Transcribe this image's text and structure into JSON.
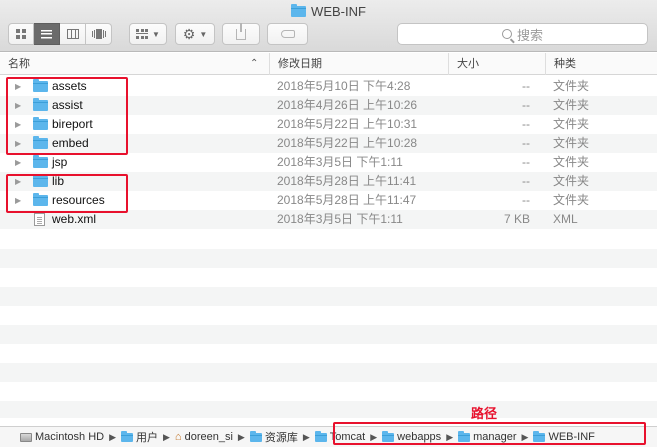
{
  "window": {
    "title": "WEB-INF"
  },
  "toolbar": {
    "view_modes": [
      "icon-view",
      "list-view",
      "column-view",
      "cover-flow-view"
    ],
    "active_view": "list-view",
    "arrange_icon": "arrange-icon",
    "action_icon": "gear-icon",
    "share_icon": "share-icon",
    "tag_icon": "tag-icon"
  },
  "search": {
    "placeholder": "搜索"
  },
  "columns": {
    "name": "名称",
    "date": "修改日期",
    "size": "大小",
    "kind": "种类"
  },
  "files": [
    {
      "name": "assets",
      "date": "2018年5月10日 下午4:28",
      "size": "--",
      "kind": "文件夹",
      "type": "folder"
    },
    {
      "name": "assist",
      "date": "2018年4月26日 上午10:26",
      "size": "--",
      "kind": "文件夹",
      "type": "folder"
    },
    {
      "name": "bireport",
      "date": "2018年5月22日 上午10:31",
      "size": "--",
      "kind": "文件夹",
      "type": "folder"
    },
    {
      "name": "embed",
      "date": "2018年5月22日 上午10:28",
      "size": "--",
      "kind": "文件夹",
      "type": "folder"
    },
    {
      "name": "jsp",
      "date": "2018年3月5日 下午1:11",
      "size": "--",
      "kind": "文件夹",
      "type": "folder"
    },
    {
      "name": "lib",
      "date": "2018年5月28日 上午11:41",
      "size": "--",
      "kind": "文件夹",
      "type": "folder"
    },
    {
      "name": "resources",
      "date": "2018年5月28日 上午11:47",
      "size": "--",
      "kind": "文件夹",
      "type": "folder"
    },
    {
      "name": "web.xml",
      "date": "2018年3月5日 下午1:11",
      "size": "7 KB",
      "kind": "XML",
      "type": "file"
    }
  ],
  "pathbar": {
    "crumbs": [
      "Macintosh HD",
      "用户",
      "doreen_si",
      "资源库",
      "Tomcat",
      "webapps",
      "manager",
      "WEB-INF"
    ]
  },
  "annotation": {
    "label": "路径",
    "color": "#e8112d"
  },
  "colors": {
    "folder": "#5cb6ec",
    "zebra": "#f4f5f5",
    "accent_red": "#e8112d"
  }
}
